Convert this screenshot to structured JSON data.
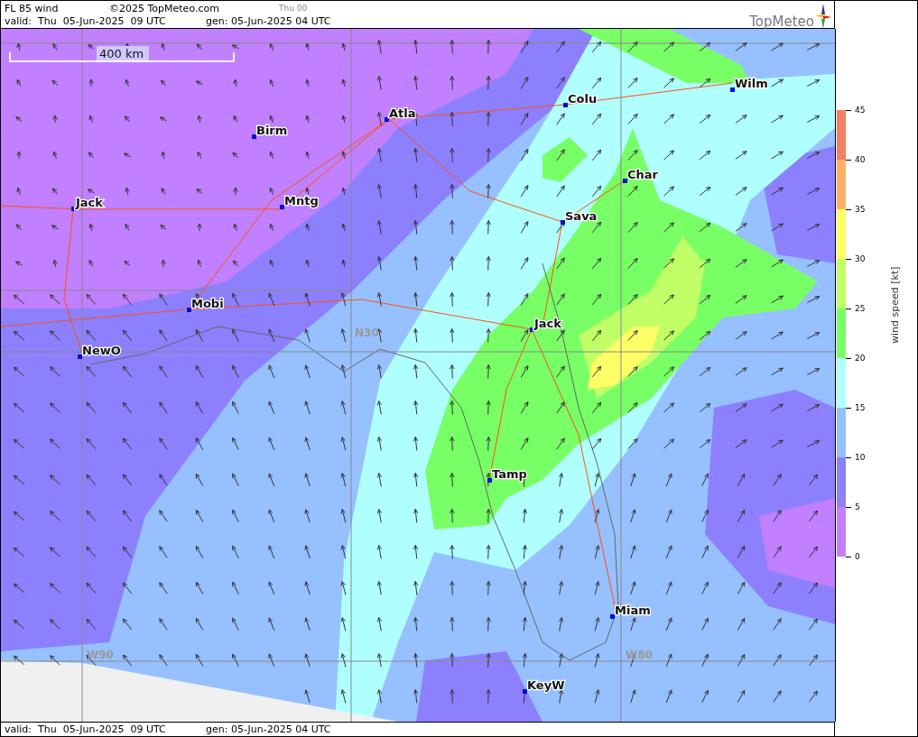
{
  "header": {
    "title": "FL 85 wind",
    "copyright": "©2025 TopMeteo.com",
    "run_label": "Thu 00",
    "valid": "valid:  Thu  05-Jun-2025  09 UTC",
    "generated": "gen: 05-Jun-2025 04 UTC",
    "logo": "TopMeteo"
  },
  "map": {
    "scale": "400 km",
    "grid_labels": [
      "N30",
      "W90",
      "W80"
    ],
    "cities": [
      "Wilm",
      "Colu",
      "Atla",
      "Birm",
      "Char",
      "Jack",
      "Mntg",
      "Sava",
      "Mobi",
      "Jack",
      "NewO",
      "Tamp",
      "Miam",
      "KeyW"
    ]
  },
  "legend": {
    "title": "wind speed [kt]",
    "ticks": [
      "45",
      "40",
      "35",
      "30",
      "25",
      "20",
      "15",
      "10",
      "5",
      "0"
    ],
    "bands": [
      {
        "color": "#f08066"
      },
      {
        "color": "#ffb066"
      },
      {
        "color": "#ffff66"
      },
      {
        "color": "#c0ff66"
      },
      {
        "color": "#78ff66"
      },
      {
        "color": "#b0ffff"
      },
      {
        "color": "#96c0ff"
      },
      {
        "color": "#8c80ff"
      },
      {
        "color": "#c080ff"
      }
    ]
  },
  "footer": {
    "valid": "valid:  Thu  05-Jun-2025  09 UTC",
    "generated": "gen: 05-Jun-2025 04 UTC"
  }
}
